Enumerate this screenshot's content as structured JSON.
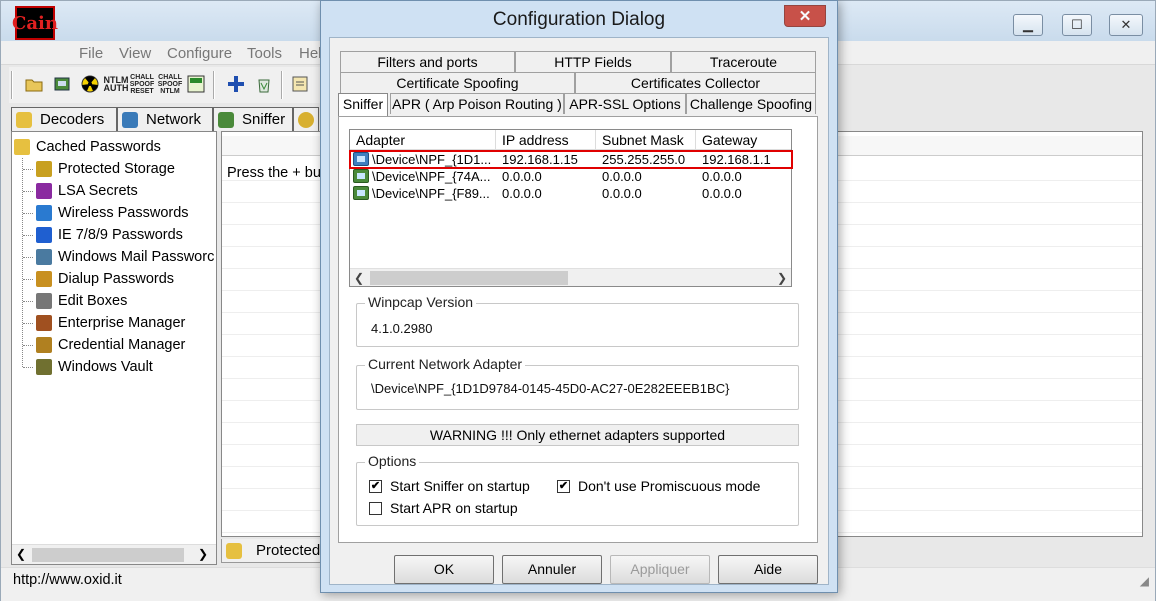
{
  "main_window": {
    "logo_text": "Cain",
    "menu": [
      "File",
      "View",
      "Configure",
      "Tools",
      "Hel"
    ],
    "tabs": [
      "Decoders",
      "Network",
      "Sniffer"
    ],
    "tree": {
      "root": "Cached Passwords",
      "items": [
        {
          "label": "Protected Storage",
          "icon": "protected-storage-icon"
        },
        {
          "label": "LSA Secrets",
          "icon": "lsa-secrets-icon"
        },
        {
          "label": "Wireless Passwords",
          "icon": "wireless-icon"
        },
        {
          "label": "IE 7/8/9 Passwords",
          "icon": "ie-icon"
        },
        {
          "label": "Windows Mail Passworc",
          "icon": "mail-icon"
        },
        {
          "label": "Dialup Passwords",
          "icon": "dialup-icon"
        },
        {
          "label": "Edit Boxes",
          "icon": "edit-box-icon"
        },
        {
          "label": "Enterprise Manager",
          "icon": "enterprise-icon"
        },
        {
          "label": "Credential Manager",
          "icon": "credential-icon"
        },
        {
          "label": "Windows Vault",
          "icon": "vault-icon"
        }
      ]
    },
    "grid_hint": "Press the + bu",
    "bottom_tab": "Protected",
    "status": "http://www.oxid.it",
    "toolbar_labels": {
      "ntlm1": "NTLM\nAUTH",
      "ntlm2": "CHALL\nSPOOF\nRESET",
      "ntlm3": "CHALL\nSPOOF\nNTLM"
    }
  },
  "dialog": {
    "title": "Configuration Dialog",
    "close_glyph": "✕",
    "tabs_row1": [
      "Filters and ports",
      "HTTP Fields",
      "Traceroute"
    ],
    "tabs_row2": [
      "Certificate Spoofing",
      "Certificates Collector"
    ],
    "tabs_row3": [
      "Sniffer",
      "APR ( Arp Poison Routing )",
      "APR-SSL Options",
      "Challenge Spoofing"
    ],
    "adapter_columns": [
      "Adapter",
      "IP address",
      "Subnet Mask",
      "Gateway"
    ],
    "adapters": [
      {
        "adapter": "\\Device\\NPF_{1D1...",
        "ip": "192.168.1.15",
        "mask": "255.255.255.0",
        "gateway": "192.168.1.1",
        "selected": true
      },
      {
        "adapter": "\\Device\\NPF_{74A...",
        "ip": "0.0.0.0",
        "mask": "0.0.0.0",
        "gateway": "0.0.0.0",
        "selected": false
      },
      {
        "adapter": "\\Device\\NPF_{F89...",
        "ip": "0.0.0.0",
        "mask": "0.0.0.0",
        "gateway": "0.0.0.0",
        "selected": false
      }
    ],
    "winpcap_label": "Winpcap Version",
    "winpcap_value": "4.1.0.2980",
    "current_adapter_label": "Current Network Adapter",
    "current_adapter_value": "\\Device\\NPF_{1D1D9784-0145-45D0-AC27-0E282EEEB1BC}",
    "warning": "WARNING !!! Only ethernet adapters supported",
    "options_label": "Options",
    "options": {
      "start_sniffer": {
        "label": "Start Sniffer on startup",
        "checked": true
      },
      "no_promiscuous": {
        "label": "Don't use Promiscuous mode",
        "checked": true
      },
      "start_apr": {
        "label": "Start APR on startup",
        "checked": false
      }
    },
    "buttons": {
      "ok": "OK",
      "cancel": "Annuler",
      "apply": "Appliquer",
      "help": "Aide"
    },
    "check_glyph": "✔"
  }
}
